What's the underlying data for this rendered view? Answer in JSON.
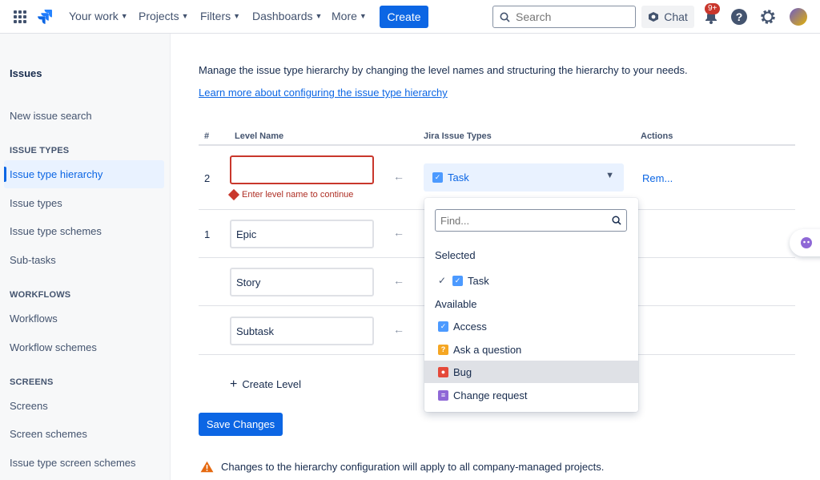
{
  "topnav": {
    "items": [
      "Your work",
      "Projects",
      "Filters",
      "Dashboards",
      "More"
    ],
    "create_label": "Create",
    "search_placeholder": "Search",
    "chat_label": "Chat",
    "notifications_badge": "9+"
  },
  "sidebar": {
    "title": "Issues",
    "new_search": "New issue search",
    "sections": {
      "issue_types": "ISSUE TYPES",
      "workflows": "WORKFLOWS",
      "screens": "SCREENS"
    },
    "items": {
      "hierarchy": "Issue type hierarchy",
      "issue_types": "Issue types",
      "issue_type_schemes": "Issue type schemes",
      "subtasks": "Sub-tasks",
      "workflows": "Workflows",
      "workflow_schemes": "Workflow schemes",
      "screens": "Screens",
      "screen_schemes": "Screen schemes",
      "issue_type_screen_schemes": "Issue type screen schemes"
    }
  },
  "main": {
    "description": "Manage the issue type hierarchy by changing the level names and structuring the hierarchy to your needs.",
    "learn_more": "Learn more about configuring the issue type hierarchy",
    "columns": {
      "num": "#",
      "level_name": "Level Name",
      "issue_types": "Jira Issue Types",
      "actions": "Actions"
    },
    "rows": [
      {
        "num": "2",
        "value": "",
        "error": "Enter level name to continue",
        "issue_type": "Task",
        "action": "Rem..."
      },
      {
        "num": "1",
        "value": "Epic"
      },
      {
        "num": "",
        "value": "Story"
      },
      {
        "num": "",
        "value": "Subtask"
      }
    ],
    "create_level": "Create Level",
    "save_label": "Save Changes",
    "warning": "Changes to the hierarchy configuration will apply to all company-managed projects."
  },
  "dropdown": {
    "find_placeholder": "Find...",
    "selected_label": "Selected",
    "selected": [
      {
        "label": "Task",
        "icon": "task-icon"
      }
    ],
    "available_label": "Available",
    "available": [
      {
        "label": "Access",
        "icon": "task-icon"
      },
      {
        "label": "Ask a question",
        "icon": "question-icon"
      },
      {
        "label": "Bug",
        "icon": "bug-icon"
      },
      {
        "label": "Change request",
        "icon": "change-request-icon"
      }
    ]
  }
}
